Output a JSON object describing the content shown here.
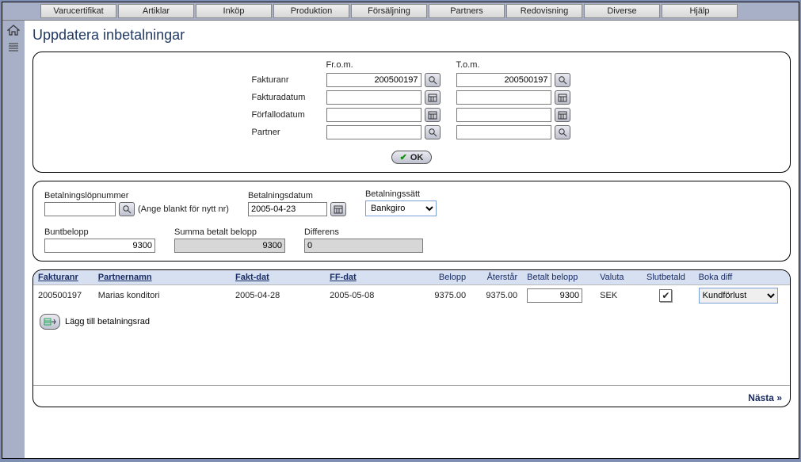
{
  "menu": [
    "Varucertifikat",
    "Artiklar",
    "Inköp",
    "Produktion",
    "Försäljning",
    "Partners",
    "Redovisning",
    "Diverse",
    "Hjälp"
  ],
  "page_title": "Uppdatera inbetalningar",
  "filter": {
    "from_header": "Fr.o.m.",
    "to_header": "T.o.m.",
    "rows": {
      "fakturanr": {
        "label": "Fakturanr",
        "from": "200500197",
        "to": "200500197",
        "icon": "search"
      },
      "fakturadatum": {
        "label": "Fakturadatum",
        "from": "",
        "to": "",
        "icon": "calendar"
      },
      "forfallodatum": {
        "label": "Förfallodatum",
        "from": "",
        "to": "",
        "icon": "calendar"
      },
      "partner": {
        "label": "Partner",
        "from": "",
        "to": "",
        "icon": "search"
      }
    },
    "ok_label": "OK"
  },
  "payment": {
    "lopnr_label": "Betalningslöpnummer",
    "lopnr_value": "",
    "lopnr_hint": "(Ange blankt för nytt nr)",
    "datum_label": "Betalningsdatum",
    "datum_value": "2005-04-23",
    "satt_label": "Betalningssätt",
    "satt_value": "Bankgiro",
    "bunt_label": "Buntbelopp",
    "bunt_value": "9300",
    "summa_label": "Summa betalt belopp",
    "summa_value": "9300",
    "diff_label": "Differens",
    "diff_value": "0"
  },
  "table": {
    "headers": {
      "fakturanr": "Fakturanr",
      "partnernamn": "Partnernamn",
      "faktdat": "Fakt-dat",
      "ffdat": "FF-dat",
      "belopp": "Belopp",
      "aterstar": "Återstår",
      "betalt": "Betalt belopp",
      "valuta": "Valuta",
      "slutbetald": "Slutbetald",
      "bokadiff": "Boka diff"
    },
    "rows": [
      {
        "fakturanr": "200500197",
        "partnernamn": "Marias konditori",
        "faktdat": "2005-04-28",
        "ffdat": "2005-05-08",
        "belopp": "9375.00",
        "aterstar": "9375.00",
        "betalt": "9300",
        "valuta": "SEK",
        "slutbetald": true,
        "bokadiff": "Kundförlust"
      }
    ],
    "add_label": "Lägg till betalningsrad"
  },
  "footer": {
    "next_label": "Nästa »"
  }
}
